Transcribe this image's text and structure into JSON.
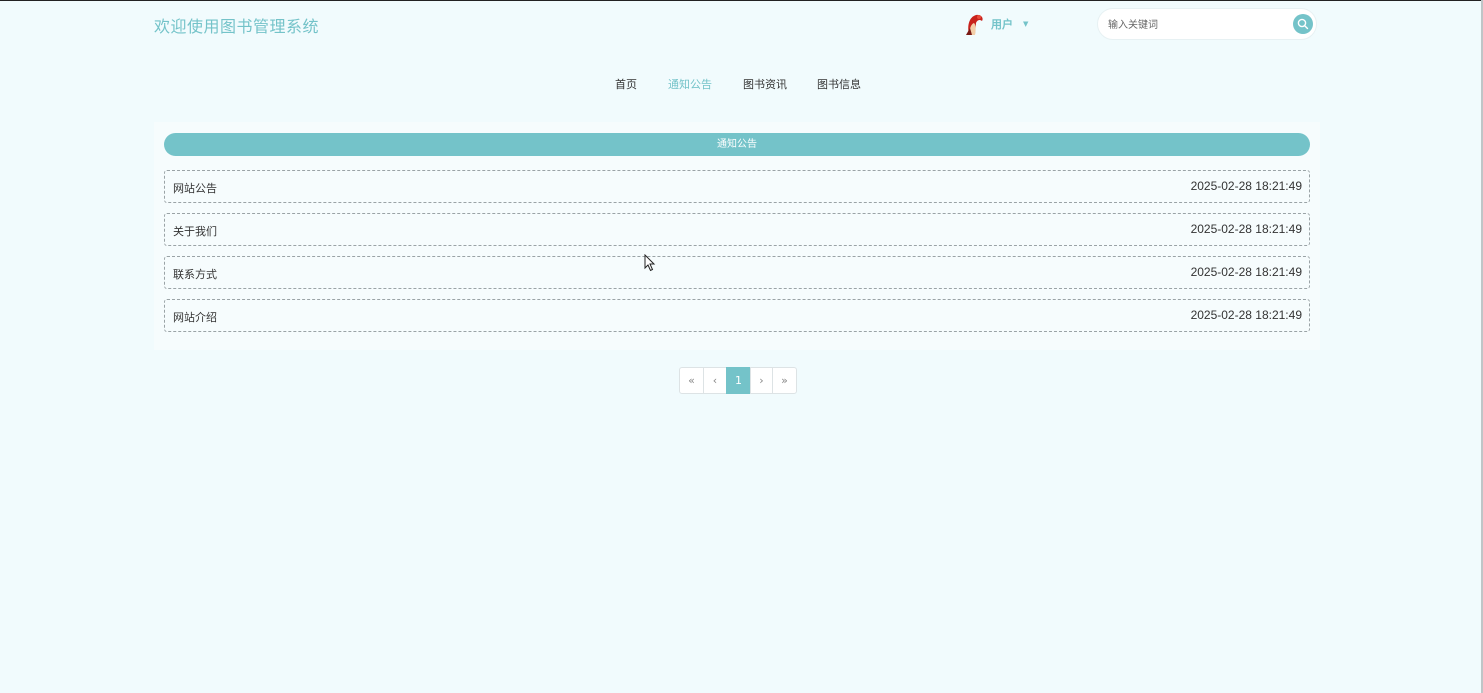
{
  "header": {
    "site_title": "欢迎使用图书管理系统",
    "user_label": "用户",
    "search_placeholder": "输入关键词"
  },
  "nav": {
    "items": [
      {
        "label": "首页",
        "active": false
      },
      {
        "label": "通知公告",
        "active": true
      },
      {
        "label": "图书资讯",
        "active": false
      },
      {
        "label": "图书信息",
        "active": false
      }
    ]
  },
  "notices": {
    "heading": "通知公告",
    "items": [
      {
        "title": "网站公告",
        "time": "2025-02-28 18:21:49"
      },
      {
        "title": "关于我们",
        "time": "2025-02-28 18:21:49"
      },
      {
        "title": "联系方式",
        "time": "2025-02-28 18:21:49"
      },
      {
        "title": "网站介绍",
        "time": "2025-02-28 18:21:49"
      }
    ]
  },
  "pagination": {
    "first": "«",
    "prev": "‹",
    "current": "1",
    "next": "›",
    "last": "»"
  },
  "colors": {
    "accent": "#74c3c9",
    "background": "#f1fbfd"
  },
  "icons": {
    "avatar": "user-avatar-icon",
    "search": "search-icon",
    "dropdown": "chevron-down-icon"
  }
}
